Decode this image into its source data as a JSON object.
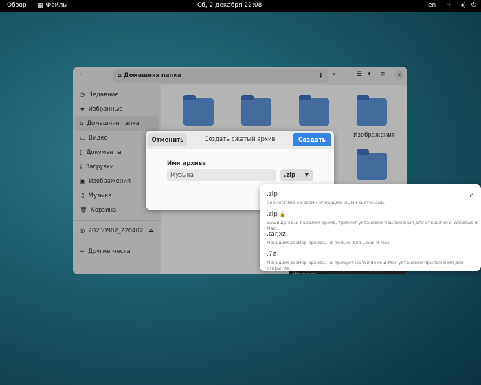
{
  "topbar": {
    "overview": "Обзор",
    "app": "Файлы",
    "clock": "Сб, 2 декабря  22:08",
    "lang": "en"
  },
  "files": {
    "path": "Домашняя папка",
    "sidebar": [
      {
        "label": "Недавние",
        "icon": "clock-icon"
      },
      {
        "label": "Избранные",
        "icon": "star-icon"
      },
      {
        "label": "Домашняя папка",
        "icon": "home-icon"
      },
      {
        "label": "Видео",
        "icon": "video-icon"
      },
      {
        "label": "Документы",
        "icon": "document-icon"
      },
      {
        "label": "Загрузки",
        "icon": "download-icon"
      },
      {
        "label": "Изображения",
        "icon": "image-icon"
      },
      {
        "label": "Музыка",
        "icon": "music-icon"
      },
      {
        "label": "Корзина",
        "icon": "trash-icon"
      }
    ],
    "drive": "20230902_220402",
    "other": "Другие места",
    "folders": [
      "Изображения"
    ],
    "status": "Выделен объект «Музыка» (внутри: 0 объектов)"
  },
  "dialog": {
    "cancel": "Отменить",
    "title": "Создать сжатый архив",
    "create": "Создать",
    "name_label": "Имя архива",
    "name_value": "Музыка",
    "format": ".zip",
    "accent": "#3584e4"
  },
  "popover": {
    "options": [
      {
        "title": ".zip",
        "desc": "Совместимо со всеми операционными системами.",
        "selected": true
      },
      {
        "title": ".zip",
        "desc": "Защищённый паролем архив, требует установки приложения для открытия в Windows и Mac.",
        "locked": true
      },
      {
        "title": ".tar.xz",
        "desc": "Меньший размер архива, но только для Linux и Mac."
      },
      {
        "title": ".7z",
        "desc": "Меньший размер архива, но требует на Windows и Mac установки приложения для открытия."
      }
    ]
  }
}
